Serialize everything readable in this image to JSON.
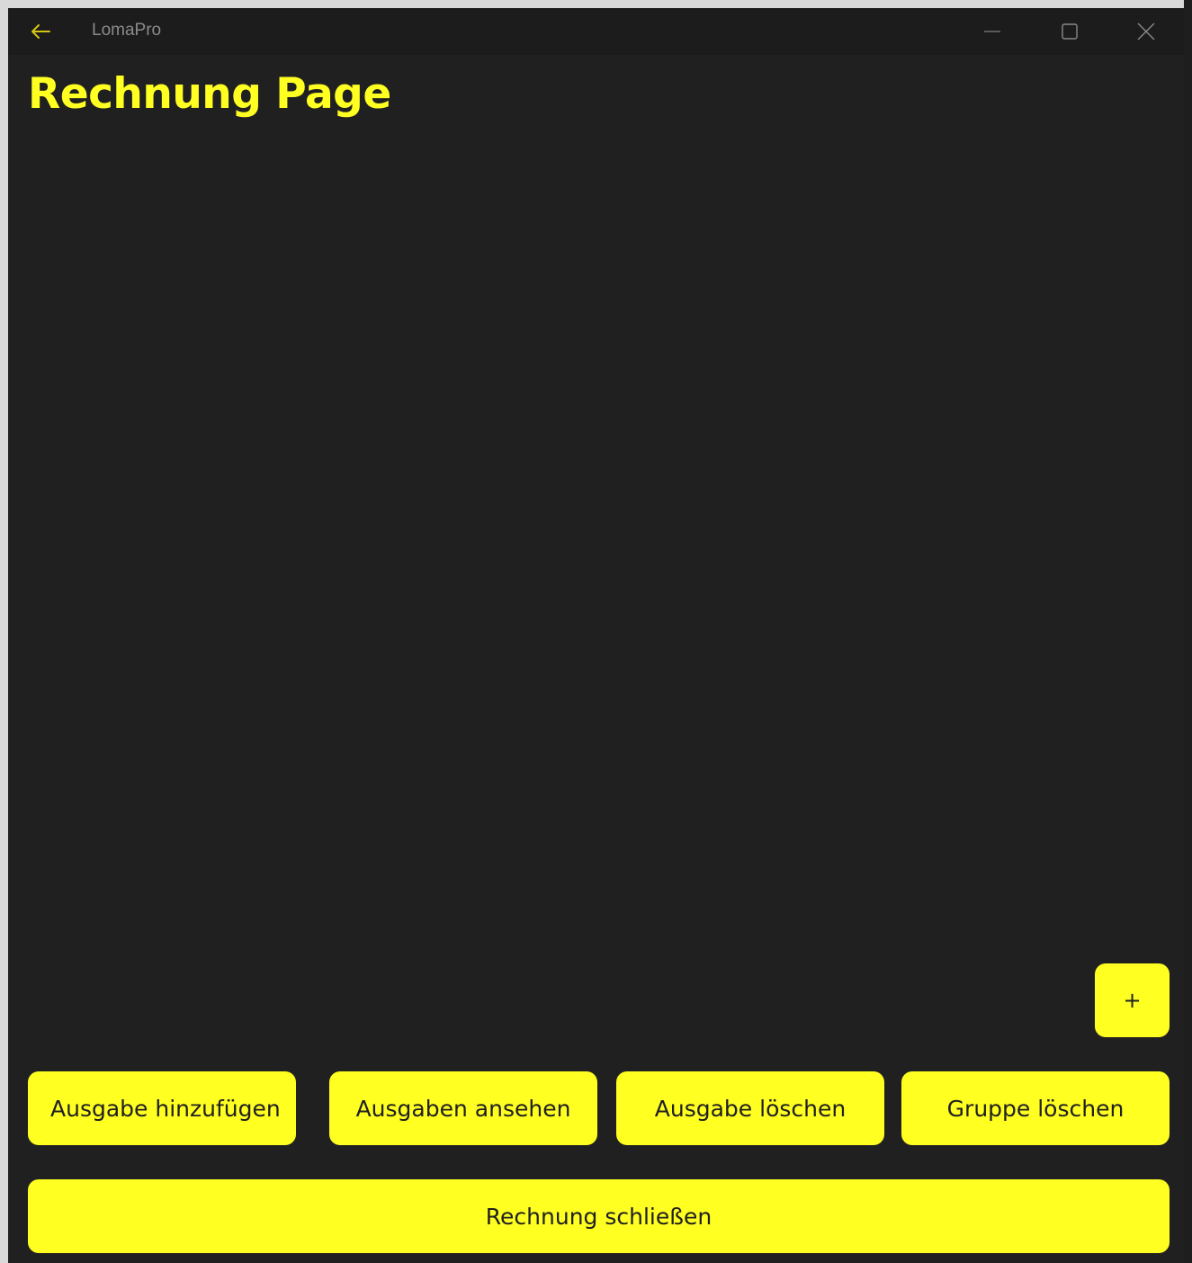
{
  "window": {
    "app_title": "LomaPro"
  },
  "page": {
    "title": "Rechnung Page"
  },
  "actions": {
    "plus_label": "+",
    "add_expense": "Ausgabe hinzufügen",
    "view_expenses": "Ausgaben ansehen",
    "delete_expense": "Ausgabe löschen",
    "delete_group": "Gruppe löschen",
    "close_invoice": "Rechnung schließen"
  },
  "icons": {
    "back": "arrow-left-icon",
    "minimize": "minimize-icon",
    "maximize": "maximize-icon",
    "close": "close-icon"
  },
  "colors": {
    "accent": "#ffff22",
    "background": "#202020",
    "titlebar": "#1c1c1c"
  }
}
